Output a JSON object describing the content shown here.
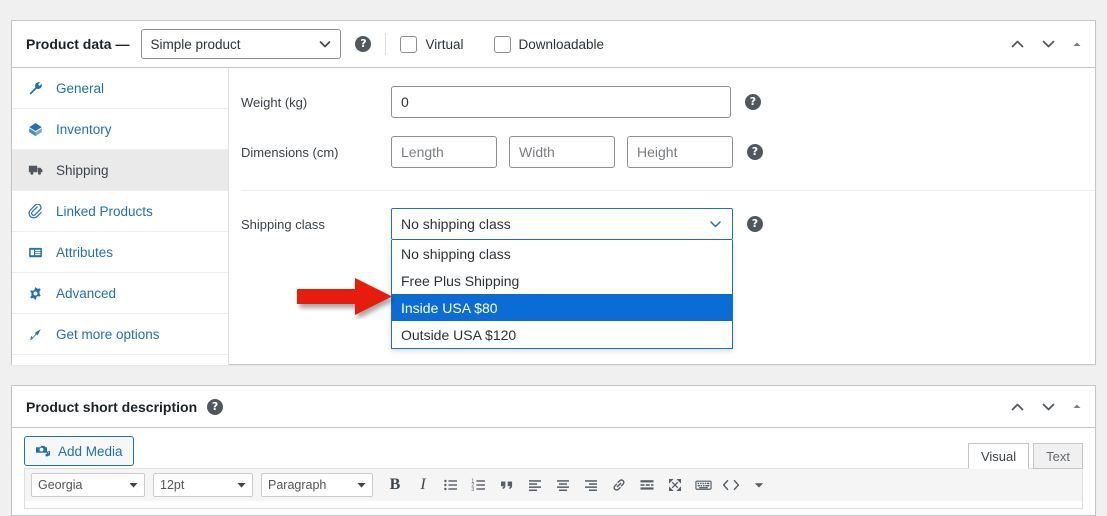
{
  "product_data": {
    "title": "Product data —",
    "type_select": {
      "value": "Simple product",
      "icon": "chevron-down-icon"
    },
    "help_icon": "help-icon",
    "checkboxes": [
      {
        "label": "Virtual",
        "checked": false
      },
      {
        "label": "Downloadable",
        "checked": false
      }
    ],
    "header_controls": [
      {
        "name": "move-up-icon",
        "glyph": "chevron-up"
      },
      {
        "name": "move-down-icon",
        "glyph": "chevron-down"
      },
      {
        "name": "toggle-panel-icon",
        "glyph": "triangle-up"
      }
    ],
    "tabs": [
      {
        "label": "General",
        "icon": "wrench-icon",
        "active": false
      },
      {
        "label": "Inventory",
        "icon": "inventory-box-icon",
        "active": false
      },
      {
        "label": "Shipping",
        "icon": "truck-icon",
        "active": true
      },
      {
        "label": "Linked Products",
        "icon": "paperclip-icon",
        "active": false
      },
      {
        "label": "Attributes",
        "icon": "attributes-table-icon",
        "active": false
      },
      {
        "label": "Advanced",
        "icon": "gear-icon",
        "active": false
      },
      {
        "label": "Get more options",
        "icon": "plugin-icon",
        "active": false
      }
    ],
    "fields": {
      "weight": {
        "label": "Weight (kg)",
        "value": "0"
      },
      "dimensions": {
        "label": "Dimensions (cm)",
        "inputs": [
          {
            "placeholder": "Length",
            "value": ""
          },
          {
            "placeholder": "Width",
            "value": ""
          },
          {
            "placeholder": "Height",
            "value": ""
          }
        ]
      },
      "shipping_class": {
        "label": "Shipping class",
        "value": "No shipping class",
        "expanded": true,
        "options": [
          {
            "label": "No shipping class",
            "selected": false
          },
          {
            "label": "Free Plus Shipping",
            "selected": false
          },
          {
            "label": "Inside USA $80",
            "selected": true
          },
          {
            "label": "Outside USA $120",
            "selected": false
          }
        ]
      }
    }
  },
  "short_description": {
    "title": "Product short description",
    "help_icon": "help-icon",
    "header_controls": [
      {
        "name": "move-up-icon",
        "glyph": "chevron-up"
      },
      {
        "name": "move-down-icon",
        "glyph": "chevron-down"
      },
      {
        "name": "toggle-panel-icon",
        "glyph": "triangle-up"
      }
    ],
    "add_media_label": "Add Media",
    "editor_tabs": [
      {
        "label": "Visual",
        "active": true
      },
      {
        "label": "Text",
        "active": false
      }
    ],
    "toolbar": {
      "font_family": "Georgia",
      "font_size": "12pt",
      "format": "Paragraph",
      "buttons": [
        "bold-icon",
        "italic-icon",
        "bullet-list-icon",
        "numbered-list-icon",
        "blockquote-icon",
        "align-left-icon",
        "align-center-icon",
        "align-right-icon",
        "link-icon",
        "read-more-icon",
        "fullscreen-icon",
        "keyboard-shortcuts-icon",
        "source-code-icon",
        "toolbar-toggle-icon"
      ]
    }
  },
  "colors": {
    "accent_blue": "#2271b1",
    "highlight_blue": "#0a6cd4",
    "arrow_red": "#e81f09",
    "page_bg": "#f0f0f1",
    "panel_border": "#c3c4c7",
    "active_tab_bg": "#eaeaea"
  }
}
